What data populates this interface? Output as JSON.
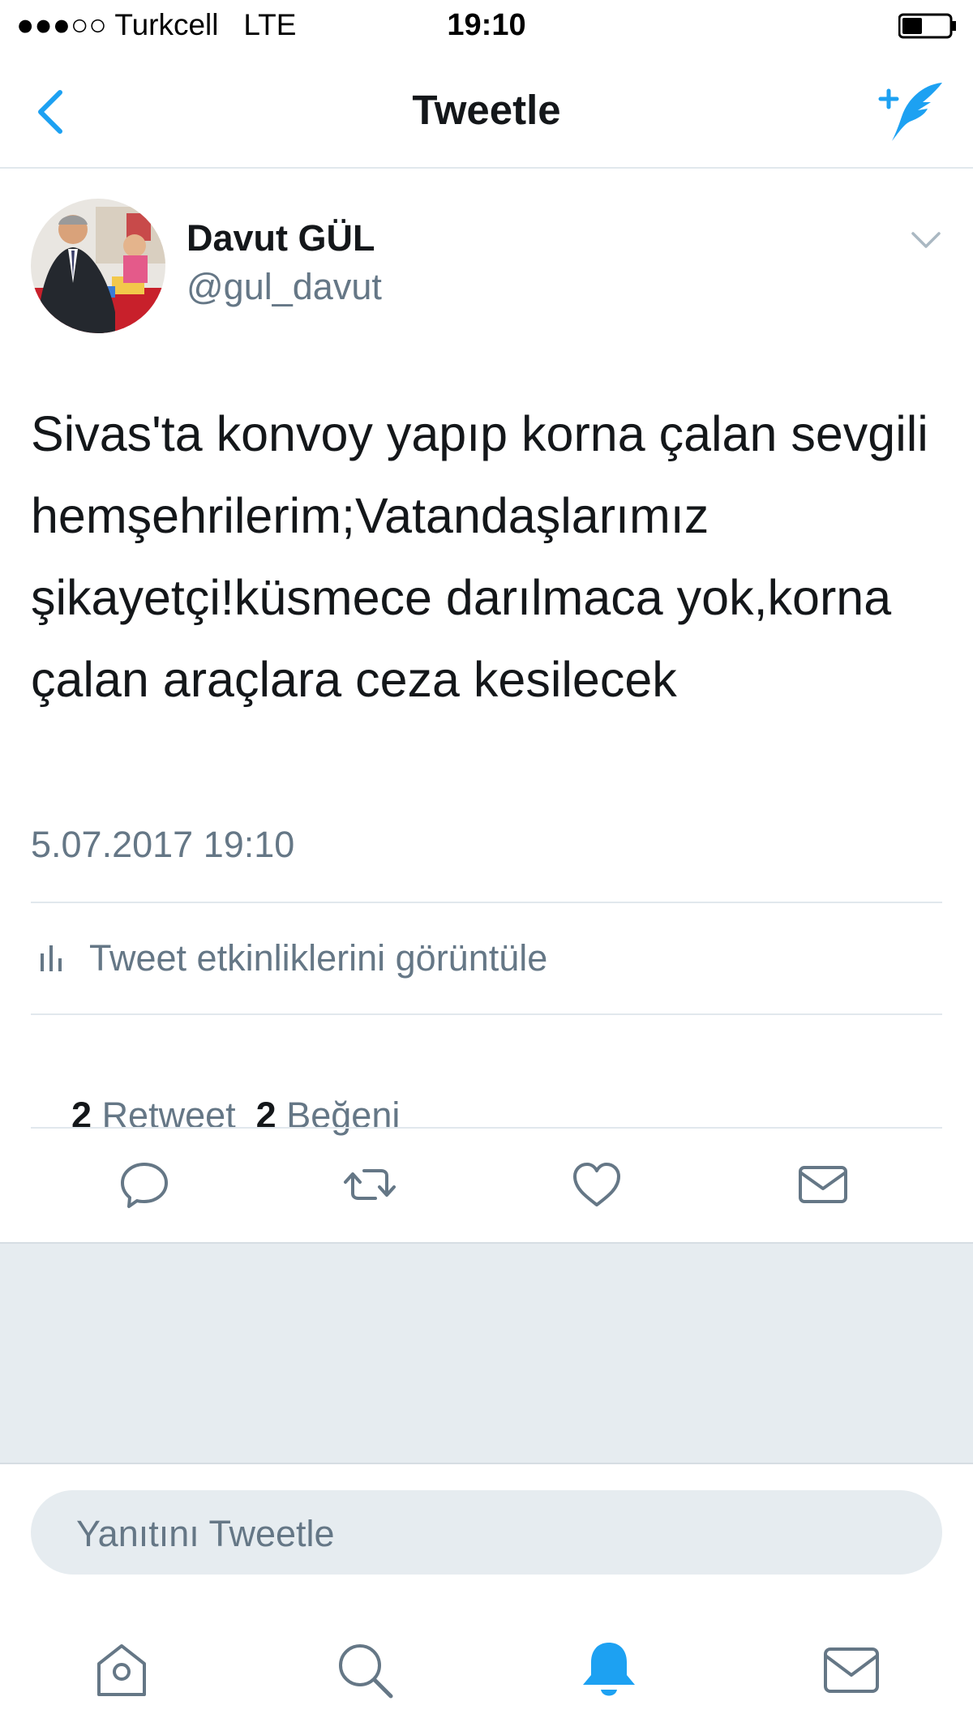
{
  "status_bar": {
    "carrier": "●●●○○ Turkcell   LTE",
    "time": "19:10"
  },
  "nav": {
    "title": "Tweetle",
    "back_icon": "chevron-left-icon",
    "compose_icon": "compose-tweet-icon",
    "accent_color": "#1da1f2"
  },
  "tweet": {
    "author_name": "Davut GÜL",
    "author_handle": "@gul_davut",
    "text": "Sivas'ta konvoy yapıp korna çalan sevgili hemşehrilerim;Vatandaşlarımız şikayetçi!küsmece darılmaca yok,korna çalan araçlara ceza kesilecek",
    "timestamp": "5.07.2017 19:10",
    "activity_label": "Tweet etkinliklerini görüntüle",
    "retweet_count": "2",
    "retweet_label": "Retweet",
    "like_count": "2",
    "like_label": "Beğeni"
  },
  "actions": [
    "reply-icon",
    "retweet-icon",
    "like-icon",
    "direct-message-icon"
  ],
  "reply": {
    "placeholder": "Yanıtını Tweetle"
  },
  "tab_bar": {
    "items": [
      "home-icon",
      "search-icon",
      "notifications-icon",
      "messages-icon"
    ],
    "active": "notifications-icon"
  }
}
